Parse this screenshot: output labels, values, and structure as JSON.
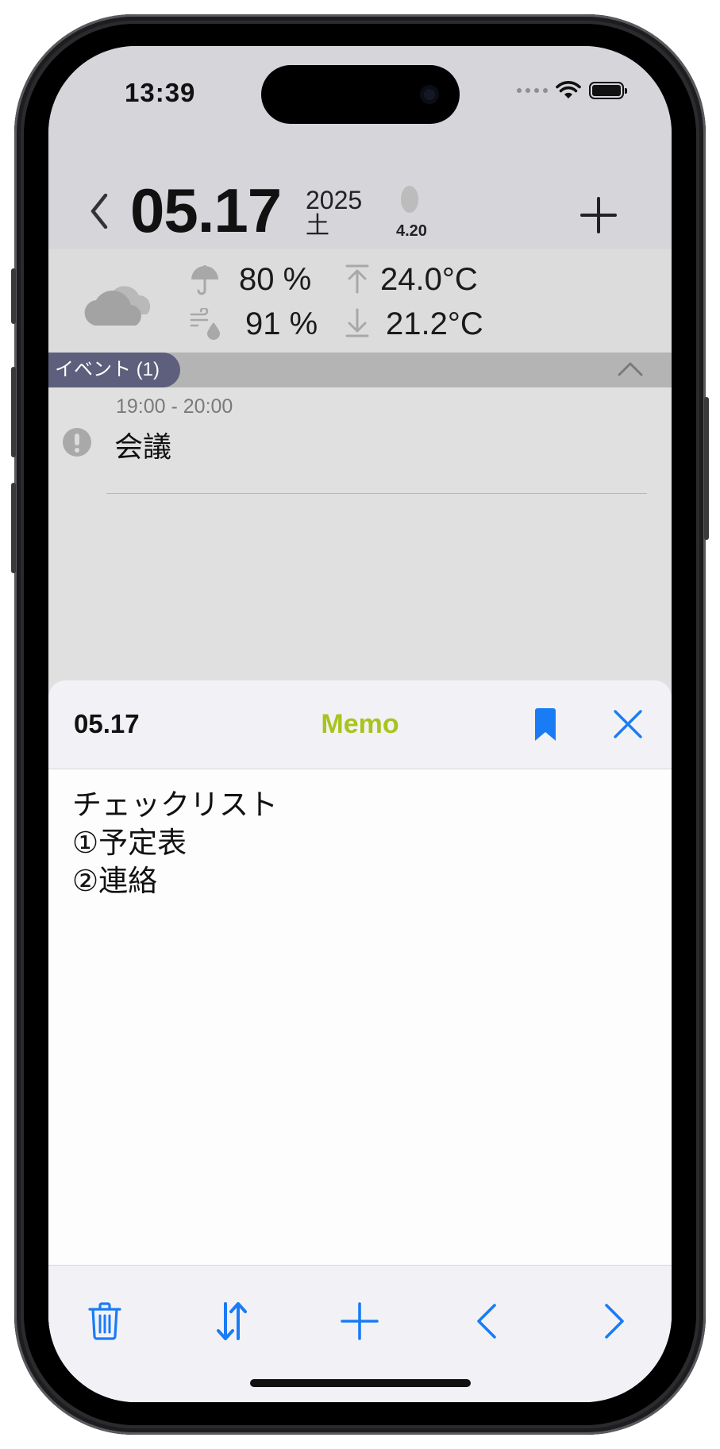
{
  "status_bar": {
    "time": "13:39"
  },
  "header": {
    "date": "05.17",
    "year": "2025",
    "weekday": "土",
    "moon_age": "4.20"
  },
  "weather": {
    "rain_chance": "80 %",
    "humidity": "91 %",
    "temp_high": "24.0°C",
    "temp_low": "21.2°C"
  },
  "events": {
    "section_label": "イベント (1)",
    "items": [
      {
        "time": "19:00 - 20:00",
        "title": "会議"
      }
    ]
  },
  "memo_sheet": {
    "date": "05.17",
    "title": "Memo",
    "lines": [
      "チェックリスト",
      "①予定表",
      "②連絡"
    ]
  },
  "colors": {
    "accent": "#1a7cf5",
    "memo_title": "#a8c41c",
    "events_pill": "#5e5f7d"
  },
  "toolbar": {
    "icons": [
      "trash-icon",
      "sort-icon",
      "plus-icon",
      "chevron-left-icon",
      "chevron-right-icon"
    ]
  }
}
